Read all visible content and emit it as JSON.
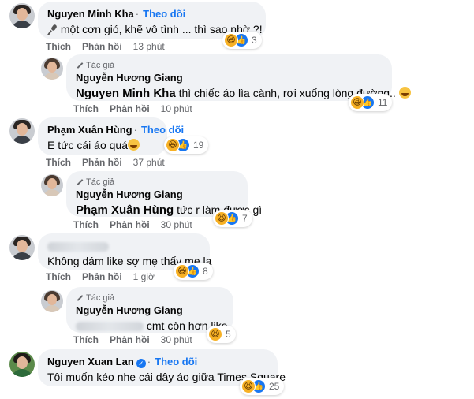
{
  "comments": [
    {
      "author": "Nguyen Minh Kha",
      "follow": "Theo dõi",
      "text": "một cơn gió, khẽ vô tình ... thì sao nhờ ?!",
      "like": "Thích",
      "reply": "Phản hồi",
      "time": "13 phút",
      "reactions": "3"
    },
    {
      "badge": "Tác giả",
      "author": "Nguyễn Hương Giang",
      "mention": "Nguyen Minh Kha",
      "text": "thì chiếc áo lìa cành, rơi xuống lòng đường..",
      "like": "Thích",
      "reply": "Phản hồi",
      "time": "10 phút",
      "reactions": "11"
    },
    {
      "author": "Phạm Xuân Hùng",
      "follow": "Theo dõi",
      "text": "E tức cái áo quá",
      "like": "Thích",
      "reply": "Phản hồi",
      "time": "37 phút",
      "reactions": "19"
    },
    {
      "badge": "Tác giả",
      "author": "Nguyễn Hương Giang",
      "mention": "Phạm Xuân Hùng",
      "text": "tức r làm được gì",
      "like": "Thích",
      "reply": "Phản hồi",
      "time": "30 phút",
      "reactions": "7"
    },
    {
      "text": "Không dám like sợ mẹ thấy mẹ la",
      "like": "Thích",
      "reply": "Phản hồi",
      "time": "1 giờ",
      "reactions": "8"
    },
    {
      "badge": "Tác giả",
      "author": "Nguyễn Hương Giang",
      "text": "cmt còn hơn like",
      "like": "Thích",
      "reply": "Phản hồi",
      "time": "30 phút",
      "reactions": "5"
    },
    {
      "author": "Nguyen Xuan Lan",
      "follow": "Theo dõi",
      "text": "Tôi muốn kéo nhẹ cái dây áo giữa Times Square",
      "reactions": "25"
    }
  ],
  "colors": {
    "bubble": "#f0f2f5",
    "link": "#1877f2",
    "meta": "#65676b",
    "haha": "#f7b125",
    "like": "#1877f2"
  },
  "icons": [
    "pencil-icon",
    "haha-reaction-icon",
    "like-reaction-icon",
    "verified-badge-icon",
    "microphone-emoji-icon",
    "laughing-emoji-icon"
  ]
}
